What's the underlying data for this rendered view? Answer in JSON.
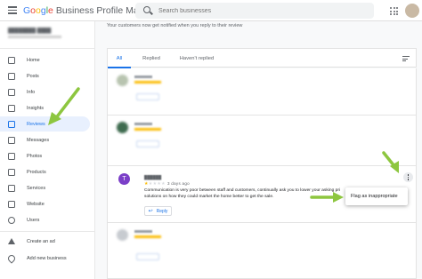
{
  "app": {
    "title_g": [
      "G",
      "o",
      "o",
      "g",
      "l",
      "e"
    ],
    "title_rest": "Business Profile Manager"
  },
  "search": {
    "placeholder": "Search businesses"
  },
  "sidebar": {
    "items": [
      {
        "label": "Home",
        "icon": "grid-icon"
      },
      {
        "label": "Posts",
        "icon": "post-icon"
      },
      {
        "label": "Info",
        "icon": "store-icon"
      },
      {
        "label": "Insights",
        "icon": "bar-chart-icon"
      },
      {
        "label": "Reviews",
        "icon": "review-icon",
        "active": true
      },
      {
        "label": "Messages",
        "icon": "chat-icon"
      },
      {
        "label": "Photos",
        "icon": "photo-icon"
      },
      {
        "label": "Products",
        "icon": "basket-icon"
      },
      {
        "label": "Services",
        "icon": "list-icon"
      },
      {
        "label": "Website",
        "icon": "web-icon"
      },
      {
        "label": "Users",
        "icon": "add-user-icon"
      }
    ],
    "bottom": [
      {
        "label": "Create an ad",
        "icon": "ads-icon"
      },
      {
        "label": "Add new business",
        "icon": "pin-icon"
      }
    ]
  },
  "main": {
    "notice": "Your customers now get notified when you reply to their review",
    "tabs": [
      {
        "label": "All"
      },
      {
        "label": "Replied"
      },
      {
        "label": "Haven't replied"
      }
    ]
  },
  "review": {
    "avatar_letter": "T",
    "age": "3 days ago",
    "stars": 1,
    "text": "Communication is very poor between staff and customers, continually ask you to lower your asking pri solutions on how they could market the home better to get the sale.",
    "reply_label": "Reply"
  },
  "menu": {
    "flag_label": "Flag as inappropriate"
  },
  "colors": {
    "accent": "#1a73e8",
    "arrow": "#8dc63f",
    "star": "#fbbc05",
    "avatar": "#7b3fc8"
  }
}
